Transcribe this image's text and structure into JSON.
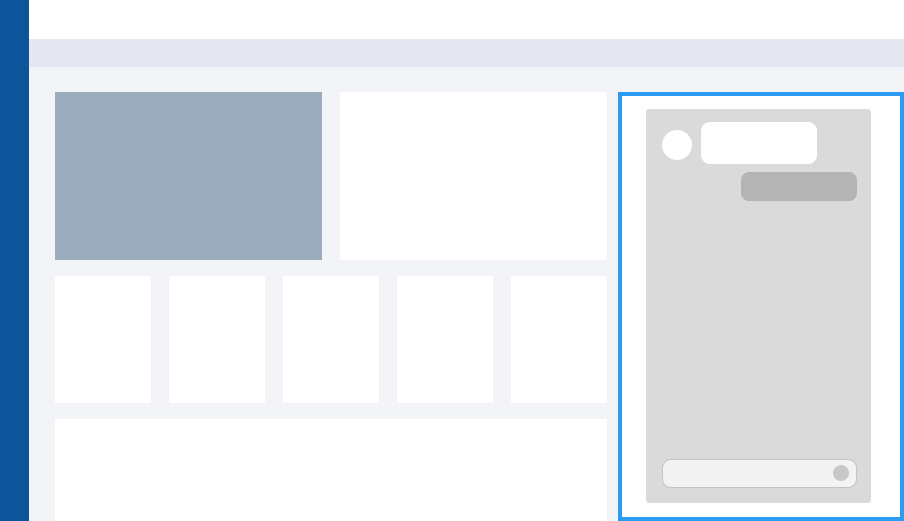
{
  "app": {
    "accent_color": "#0d549a",
    "highlight_color": "#2b9cf2"
  },
  "dashboard": {
    "tiles": [
      "",
      "",
      "",
      "",
      ""
    ]
  },
  "chat": {
    "incoming_message": "",
    "outgoing_message": "",
    "input_placeholder": ""
  }
}
